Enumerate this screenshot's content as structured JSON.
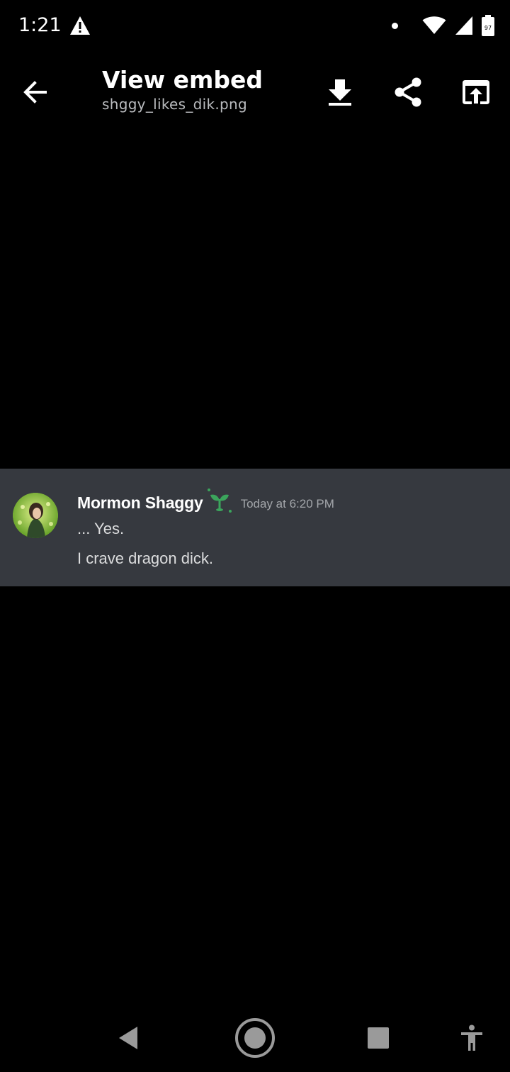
{
  "status_bar": {
    "time": "1:21",
    "battery_level": "97",
    "icons": [
      "warning-icon",
      "notification-dot-icon",
      "wifi-icon",
      "signal-icon",
      "battery-icon"
    ]
  },
  "app_bar": {
    "title": "View embed",
    "subtitle": "shggy_likes_dik.png",
    "actions": [
      "back-arrow-icon",
      "download-icon",
      "share-icon",
      "open-external-icon"
    ]
  },
  "embed": {
    "author": "Mormon Shaggy",
    "timestamp": "Today at 6:20 PM",
    "lines": [
      "... Yes.",
      "I crave dragon dick."
    ],
    "background_color": "#36393f",
    "author_color": "#ffffff",
    "timestamp_color": "#a3a6aa",
    "text_color": "#dcddde",
    "badge_icon": "sprout-icon",
    "badge_color": "#3ba55c"
  },
  "nav_bar": {
    "buttons": [
      "nav-back-icon",
      "nav-home-icon",
      "nav-recents-icon",
      "accessibility-icon"
    ]
  }
}
